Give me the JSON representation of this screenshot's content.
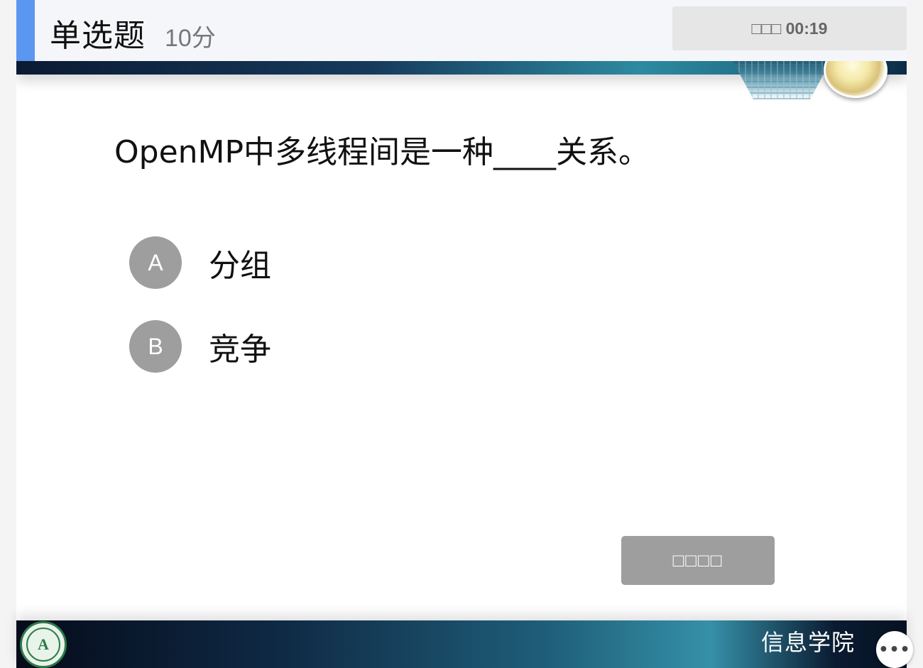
{
  "header": {
    "question_type": "单选题",
    "score": "10分",
    "timer_label": "□□□",
    "timer_value": "00:19"
  },
  "question": {
    "text": "OpenMP中多线程间是一种____关系。"
  },
  "options": [
    {
      "letter": "A",
      "text": "分组"
    },
    {
      "letter": "B",
      "text": "竞争"
    }
  ],
  "submit_label": "□□□□",
  "footer": {
    "logo_text": "A",
    "title": "信息学院"
  },
  "more_label": "•••",
  "colors": {
    "accent": "#5b97f0",
    "option_circle": "#9e9e9e",
    "button": "#9e9e9e"
  }
}
